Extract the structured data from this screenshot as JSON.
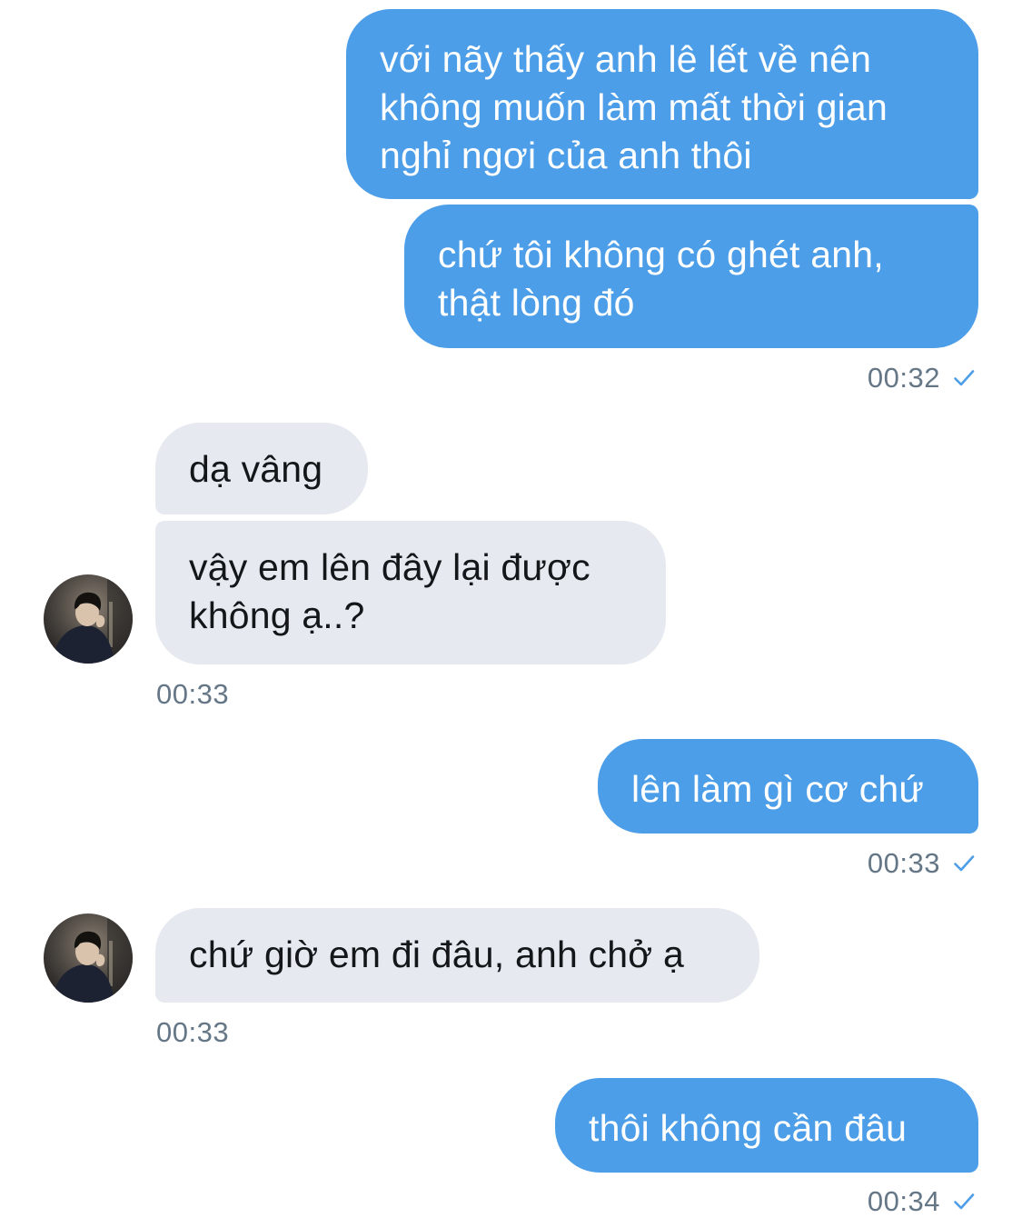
{
  "colors": {
    "outgoing_bubble": "#4d9ee9",
    "incoming_bubble": "#e6e9ef",
    "timestamp": "#657786",
    "read_check": "#4d9ee9"
  },
  "messages": [
    {
      "direction": "out",
      "text": "với nãy thấy anh lê lết về nên\nkhông muốn làm mất thời gian\nnghỉ ngơi của anh thôi"
    },
    {
      "direction": "out",
      "text": "chứ tôi không có ghét anh,\nthật lòng đó",
      "time": "00:32",
      "status_icon": "check-icon"
    },
    {
      "direction": "in",
      "text": "dạ vâng"
    },
    {
      "direction": "in",
      "text": "vậy em lên đây lại được\nkhông ạ..?",
      "time": "00:33",
      "avatar": "avatar-photo"
    },
    {
      "direction": "out",
      "text": "lên làm gì cơ chứ",
      "time": "00:33",
      "status_icon": "check-icon"
    },
    {
      "direction": "in",
      "text": "chứ giờ em đi đâu, anh chở ạ",
      "time": "00:33",
      "avatar": "avatar-photo"
    },
    {
      "direction": "out",
      "text": "thôi không cần đâu",
      "time": "00:34",
      "status_icon": "check-icon"
    }
  ]
}
